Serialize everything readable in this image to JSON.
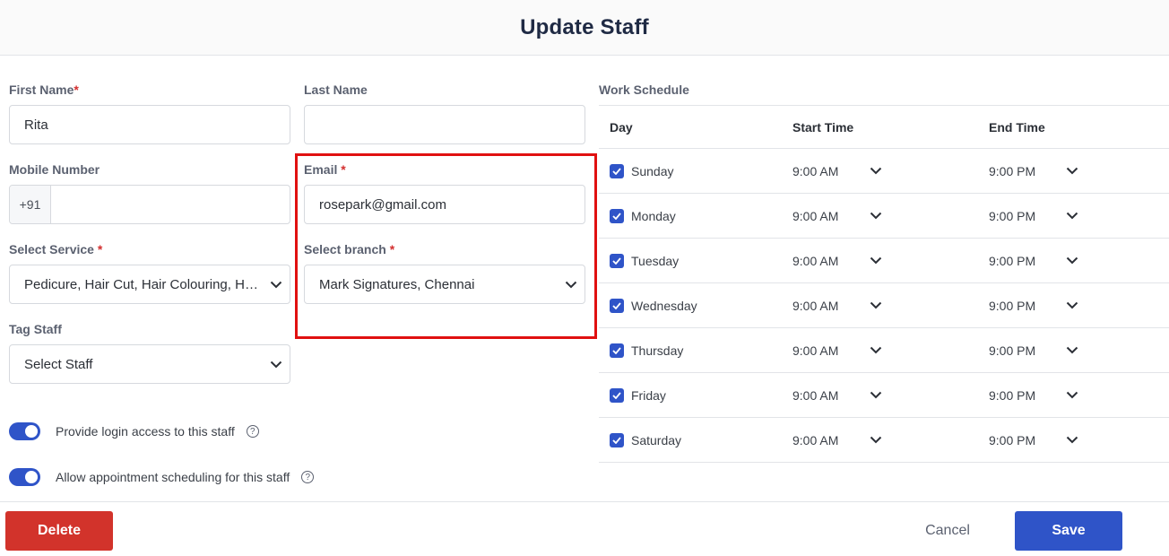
{
  "header": {
    "title": "Update Staff"
  },
  "form": {
    "first_name": {
      "label": "First Name",
      "required": "*",
      "value": "Rita"
    },
    "last_name": {
      "label": "Last Name",
      "value": ""
    },
    "mobile": {
      "label": "Mobile Number",
      "prefix": "+91",
      "value": ""
    },
    "email": {
      "label": "Email",
      "required": "*",
      "value": "rosepark@gmail.com"
    },
    "service": {
      "label": "Select Service",
      "required": "*",
      "value": "Pedicure, Hair Cut, Hair Colouring, Hair ..."
    },
    "branch": {
      "label": "Select branch",
      "required": "*",
      "value": "Mark Signatures, Chennai"
    },
    "tag_staff": {
      "label": "Tag Staff",
      "value": "Select Staff"
    }
  },
  "toggles": {
    "login_access": {
      "label": "Provide login access to this staff",
      "help": "?",
      "on": true
    },
    "appointment_scheduling": {
      "label": "Allow appointment scheduling for this staff",
      "help": "?",
      "on": true
    }
  },
  "schedule": {
    "title": "Work Schedule",
    "headers": {
      "day": "Day",
      "start": "Start Time",
      "end": "End Time"
    },
    "rows": [
      {
        "day": "Sunday",
        "start": "9:00 AM",
        "end": "9:00 PM",
        "checked": true
      },
      {
        "day": "Monday",
        "start": "9:00 AM",
        "end": "9:00 PM",
        "checked": true
      },
      {
        "day": "Tuesday",
        "start": "9:00 AM",
        "end": "9:00 PM",
        "checked": true
      },
      {
        "day": "Wednesday",
        "start": "9:00 AM",
        "end": "9:00 PM",
        "checked": true
      },
      {
        "day": "Thursday",
        "start": "9:00 AM",
        "end": "9:00 PM",
        "checked": true
      },
      {
        "day": "Friday",
        "start": "9:00 AM",
        "end": "9:00 PM",
        "checked": true
      },
      {
        "day": "Saturday",
        "start": "9:00 AM",
        "end": "9:00 PM",
        "checked": true
      }
    ]
  },
  "footer": {
    "delete_label": "Delete",
    "cancel_label": "Cancel",
    "save_label": "Save"
  },
  "colors": {
    "primary": "#2f54c8",
    "danger": "#d2332b",
    "highlight": "#e01010"
  }
}
